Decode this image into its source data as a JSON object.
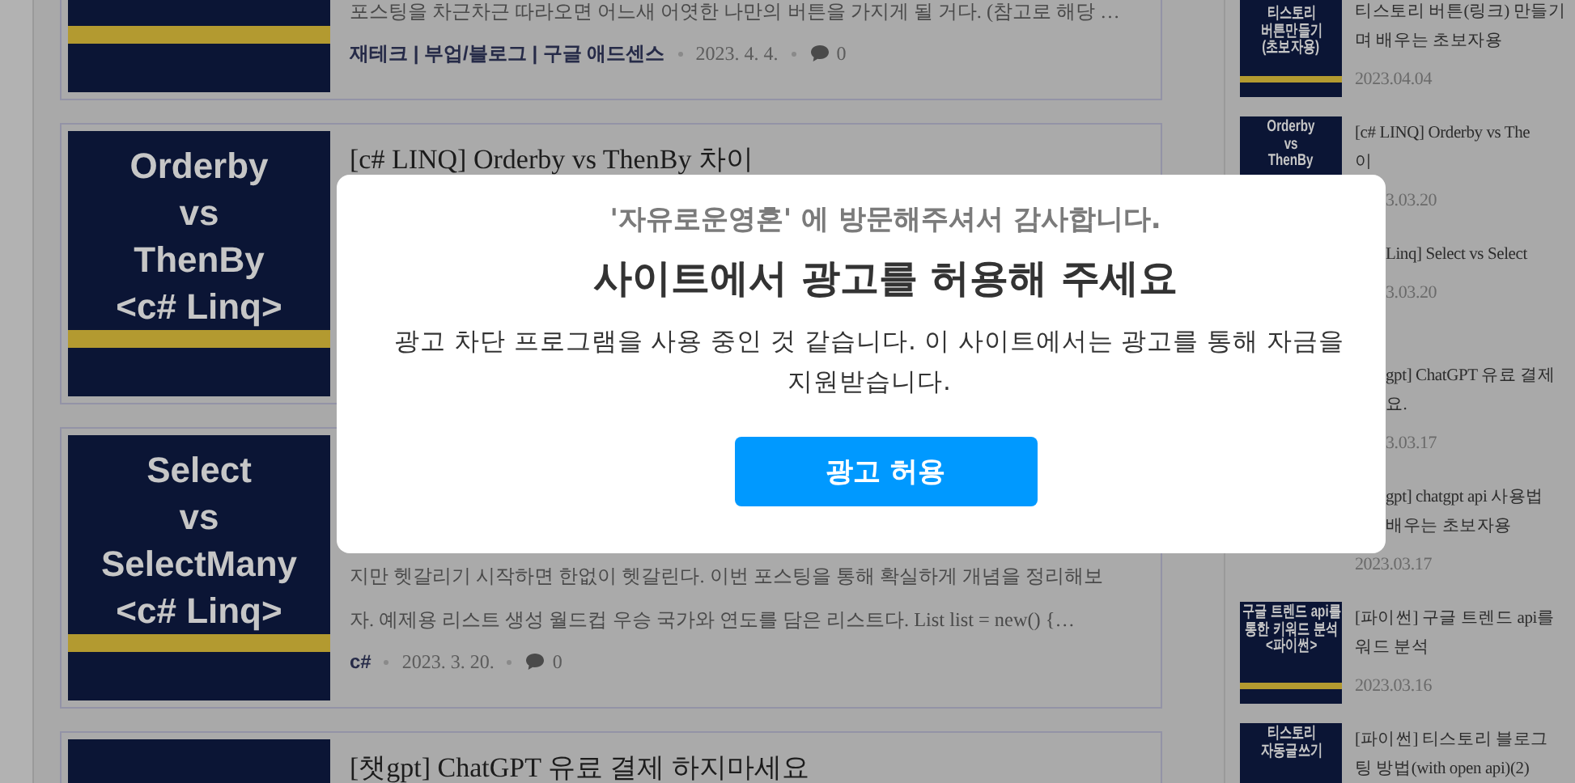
{
  "posts": [
    {
      "excerpt_lines": [
        "포스팅을 차근차근 따라오면 어느새 어엿한 나만의 버튼을 가지게 될 거다. (참고로 해당 …"
      ],
      "category": "재테크 | 부업/블로그 | 구글 애드센스",
      "date": "2023. 4. 4.",
      "comments": "0"
    },
    {
      "thumb_lines": [
        "Orderby",
        "vs",
        "ThenBy",
        "<c# Linq>"
      ],
      "title": "[c# LINQ] Orderby vs ThenBy 차이"
    },
    {
      "thumb_lines": [
        "Select",
        "vs",
        "SelectMany",
        "<c# Linq>"
      ],
      "excerpt_lines": [
        "지만 헷갈리기 시작하면 한없이 헷갈린다. 이번 포스팅을 통해 확실하게 개념을 정리해보",
        "자. 예제용 리스트 생성 월드컵 우승 국가와 연도를 담은 리스트다. List list = new() {…"
      ],
      "category": "c#",
      "date": "2023. 3. 20.",
      "comments": "0"
    },
    {
      "title": "[챗gpt] ChatGPT 유료 결제 하지마세요"
    }
  ],
  "sidebar": {
    "items": [
      {
        "thumb_lines": [
          "티스토리",
          "버튼만들기",
          "(초보자용)"
        ],
        "title_lines": [
          "티스토리 버튼(링크) 만들기",
          "며 배우는 초보자용"
        ],
        "date": "2023.04.04"
      },
      {
        "thumb_lines": [
          "Orderby",
          "vs",
          "ThenBy"
        ],
        "title_lines": [
          "[c# LINQ] Orderby vs The",
          "이"
        ],
        "date_beside_dialog": "3.03.20"
      },
      {
        "title_lines_beside_dialog": [
          "Linq] Select vs Select"
        ],
        "date_beside_dialog": "3.03.20"
      },
      {
        "title_lines_beside_dialog": [
          "gpt] ChatGPT 유료 결제",
          "요."
        ],
        "date_beside_dialog": "3.03.17"
      },
      {
        "title_lines_beside_dialog": [
          "gpt] chatgpt api 사용법",
          "배우는 초보자용"
        ],
        "date": "2023.03.17"
      },
      {
        "thumb_lines": [
          "구글 트렌드 api를",
          "통한 키워드 분석",
          "<파이썬>"
        ],
        "title_lines": [
          "[파이썬] 구글 트렌드 api를",
          "워드 분석"
        ],
        "date": "2023.03.16"
      },
      {
        "thumb_lines": [
          "티스토리",
          "자동글쓰기"
        ],
        "title_lines": [
          "[파이썬] 티스토리 블로그",
          "팅 방법(with open api)(2)"
        ]
      }
    ]
  },
  "modal": {
    "greeting": "'자유로운영혼' 에 방문해주셔서 감사합니다.",
    "title": "사이트에서 광고를 허용해 주세요",
    "message": "광고 차단 프로그램을 사용 중인 것 같습니다. 이 사이트에서는 광고를 통해 자금을 지원받습니다.",
    "button": "광고 허용"
  }
}
